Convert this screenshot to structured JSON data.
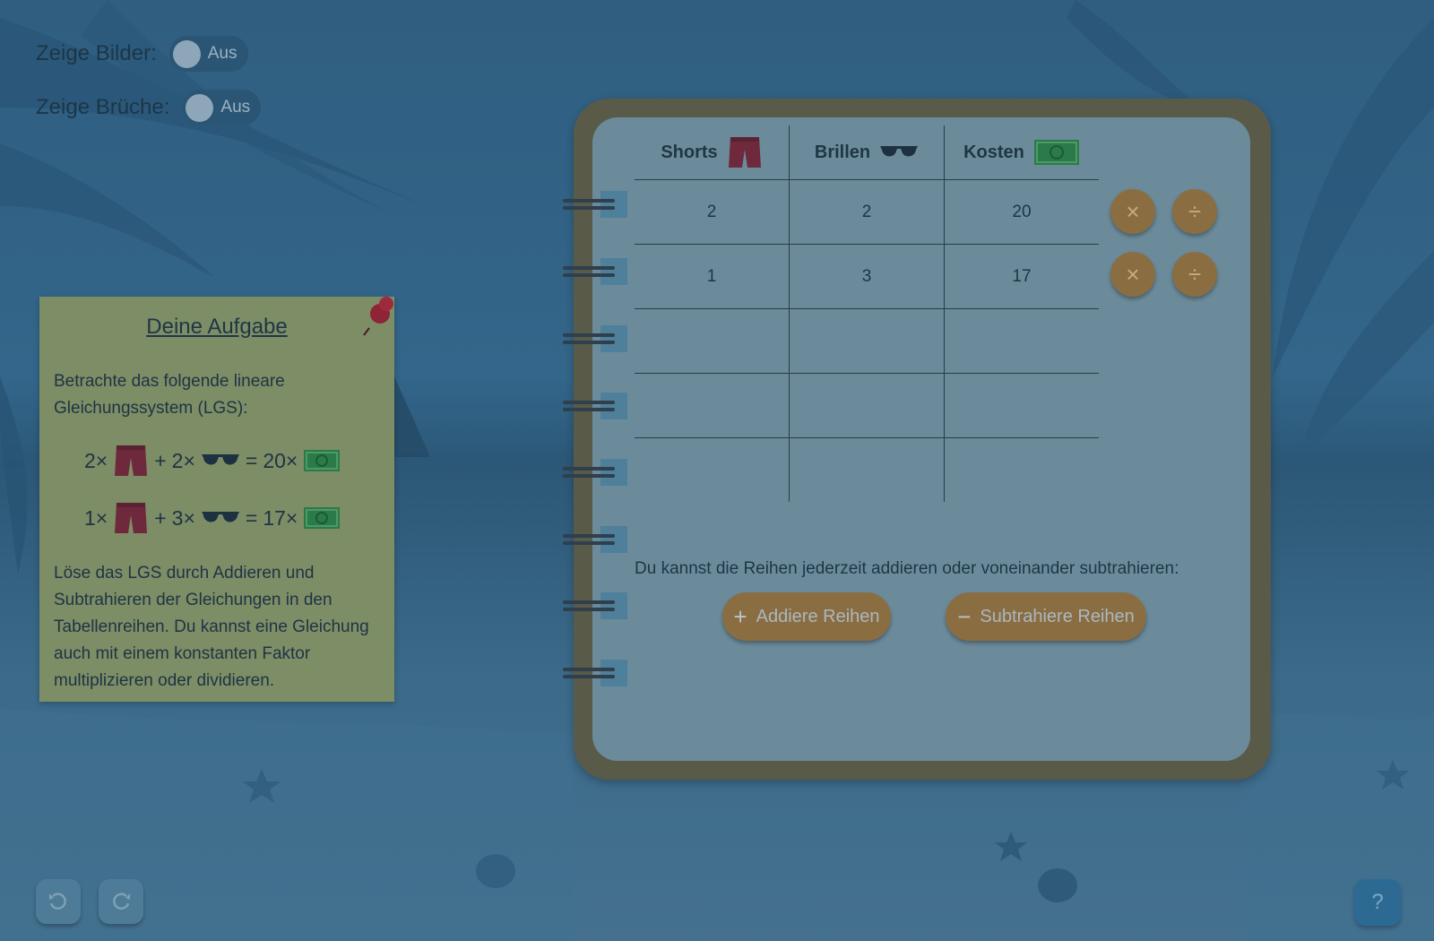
{
  "toggles": [
    {
      "label": "Zeige Bilder:",
      "state": "Aus"
    },
    {
      "label": "Zeige Brüche:",
      "state": "Aus"
    }
  ],
  "task": {
    "title": "Deine Aufgabe",
    "intro": "Betrachte das folgende lineare Gleichungssystem (LGS):",
    "equations": [
      {
        "a": "2×",
        "plus": "+",
        "b": "2×",
        "eq": "=",
        "c": "20×"
      },
      {
        "a": "1×",
        "plus": "+",
        "b": "3×",
        "eq": "=",
        "c": "17×"
      }
    ],
    "instructions": "Löse das LGS durch Addieren und Subtrahieren der Gleichungen in den Tabellenreihen. Du kannst eine Gleichung auch mit einem konstanten Faktor multiplizieren oder dividieren."
  },
  "table": {
    "headers": [
      {
        "label": "Shorts",
        "icon": "shorts-icon"
      },
      {
        "label": "Brillen",
        "icon": "sunglasses-icon"
      },
      {
        "label": "Kosten",
        "icon": "money-icon"
      }
    ],
    "rows": [
      [
        "2",
        "2",
        "20"
      ],
      [
        "1",
        "3",
        "17"
      ],
      [
        "",
        "",
        ""
      ],
      [
        "",
        "",
        ""
      ],
      [
        "",
        "",
        ""
      ]
    ]
  },
  "row_actions": {
    "multiply": "×",
    "divide": "÷"
  },
  "hint": "Du kannst die Reihen jederzeit addieren oder voneinander subtrahieren:",
  "actions": {
    "add": {
      "symbol": "+",
      "label": "Addiere Reihen"
    },
    "subtract": {
      "symbol": "−",
      "label": "Subtrahiere Reihen"
    }
  },
  "footer": {
    "undo_icon": "undo-icon",
    "redo_icon": "redo-icon",
    "help": "?"
  },
  "colors": {
    "accent_button": "#8b6d42",
    "note_paper": "#7d8d66",
    "notebook_frame": "#5a5a49",
    "help_button": "#2c6a93"
  }
}
